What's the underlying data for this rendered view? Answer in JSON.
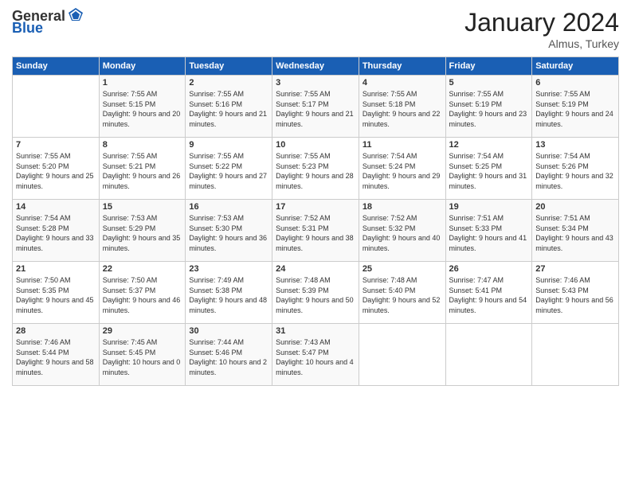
{
  "header": {
    "logo_general": "General",
    "logo_blue": "Blue",
    "month_title": "January 2024",
    "location": "Almus, Turkey"
  },
  "weekdays": [
    "Sunday",
    "Monday",
    "Tuesday",
    "Wednesday",
    "Thursday",
    "Friday",
    "Saturday"
  ],
  "weeks": [
    [
      {
        "day": "",
        "sunrise": "",
        "sunset": "",
        "daylight": ""
      },
      {
        "day": "1",
        "sunrise": "Sunrise: 7:55 AM",
        "sunset": "Sunset: 5:15 PM",
        "daylight": "Daylight: 9 hours and 20 minutes."
      },
      {
        "day": "2",
        "sunrise": "Sunrise: 7:55 AM",
        "sunset": "Sunset: 5:16 PM",
        "daylight": "Daylight: 9 hours and 21 minutes."
      },
      {
        "day": "3",
        "sunrise": "Sunrise: 7:55 AM",
        "sunset": "Sunset: 5:17 PM",
        "daylight": "Daylight: 9 hours and 21 minutes."
      },
      {
        "day": "4",
        "sunrise": "Sunrise: 7:55 AM",
        "sunset": "Sunset: 5:18 PM",
        "daylight": "Daylight: 9 hours and 22 minutes."
      },
      {
        "day": "5",
        "sunrise": "Sunrise: 7:55 AM",
        "sunset": "Sunset: 5:19 PM",
        "daylight": "Daylight: 9 hours and 23 minutes."
      },
      {
        "day": "6",
        "sunrise": "Sunrise: 7:55 AM",
        "sunset": "Sunset: 5:19 PM",
        "daylight": "Daylight: 9 hours and 24 minutes."
      }
    ],
    [
      {
        "day": "7",
        "sunrise": "Sunrise: 7:55 AM",
        "sunset": "Sunset: 5:20 PM",
        "daylight": "Daylight: 9 hours and 25 minutes."
      },
      {
        "day": "8",
        "sunrise": "Sunrise: 7:55 AM",
        "sunset": "Sunset: 5:21 PM",
        "daylight": "Daylight: 9 hours and 26 minutes."
      },
      {
        "day": "9",
        "sunrise": "Sunrise: 7:55 AM",
        "sunset": "Sunset: 5:22 PM",
        "daylight": "Daylight: 9 hours and 27 minutes."
      },
      {
        "day": "10",
        "sunrise": "Sunrise: 7:55 AM",
        "sunset": "Sunset: 5:23 PM",
        "daylight": "Daylight: 9 hours and 28 minutes."
      },
      {
        "day": "11",
        "sunrise": "Sunrise: 7:54 AM",
        "sunset": "Sunset: 5:24 PM",
        "daylight": "Daylight: 9 hours and 29 minutes."
      },
      {
        "day": "12",
        "sunrise": "Sunrise: 7:54 AM",
        "sunset": "Sunset: 5:25 PM",
        "daylight": "Daylight: 9 hours and 31 minutes."
      },
      {
        "day": "13",
        "sunrise": "Sunrise: 7:54 AM",
        "sunset": "Sunset: 5:26 PM",
        "daylight": "Daylight: 9 hours and 32 minutes."
      }
    ],
    [
      {
        "day": "14",
        "sunrise": "Sunrise: 7:54 AM",
        "sunset": "Sunset: 5:28 PM",
        "daylight": "Daylight: 9 hours and 33 minutes."
      },
      {
        "day": "15",
        "sunrise": "Sunrise: 7:53 AM",
        "sunset": "Sunset: 5:29 PM",
        "daylight": "Daylight: 9 hours and 35 minutes."
      },
      {
        "day": "16",
        "sunrise": "Sunrise: 7:53 AM",
        "sunset": "Sunset: 5:30 PM",
        "daylight": "Daylight: 9 hours and 36 minutes."
      },
      {
        "day": "17",
        "sunrise": "Sunrise: 7:52 AM",
        "sunset": "Sunset: 5:31 PM",
        "daylight": "Daylight: 9 hours and 38 minutes."
      },
      {
        "day": "18",
        "sunrise": "Sunrise: 7:52 AM",
        "sunset": "Sunset: 5:32 PM",
        "daylight": "Daylight: 9 hours and 40 minutes."
      },
      {
        "day": "19",
        "sunrise": "Sunrise: 7:51 AM",
        "sunset": "Sunset: 5:33 PM",
        "daylight": "Daylight: 9 hours and 41 minutes."
      },
      {
        "day": "20",
        "sunrise": "Sunrise: 7:51 AM",
        "sunset": "Sunset: 5:34 PM",
        "daylight": "Daylight: 9 hours and 43 minutes."
      }
    ],
    [
      {
        "day": "21",
        "sunrise": "Sunrise: 7:50 AM",
        "sunset": "Sunset: 5:35 PM",
        "daylight": "Daylight: 9 hours and 45 minutes."
      },
      {
        "day": "22",
        "sunrise": "Sunrise: 7:50 AM",
        "sunset": "Sunset: 5:37 PM",
        "daylight": "Daylight: 9 hours and 46 minutes."
      },
      {
        "day": "23",
        "sunrise": "Sunrise: 7:49 AM",
        "sunset": "Sunset: 5:38 PM",
        "daylight": "Daylight: 9 hours and 48 minutes."
      },
      {
        "day": "24",
        "sunrise": "Sunrise: 7:48 AM",
        "sunset": "Sunset: 5:39 PM",
        "daylight": "Daylight: 9 hours and 50 minutes."
      },
      {
        "day": "25",
        "sunrise": "Sunrise: 7:48 AM",
        "sunset": "Sunset: 5:40 PM",
        "daylight": "Daylight: 9 hours and 52 minutes."
      },
      {
        "day": "26",
        "sunrise": "Sunrise: 7:47 AM",
        "sunset": "Sunset: 5:41 PM",
        "daylight": "Daylight: 9 hours and 54 minutes."
      },
      {
        "day": "27",
        "sunrise": "Sunrise: 7:46 AM",
        "sunset": "Sunset: 5:43 PM",
        "daylight": "Daylight: 9 hours and 56 minutes."
      }
    ],
    [
      {
        "day": "28",
        "sunrise": "Sunrise: 7:46 AM",
        "sunset": "Sunset: 5:44 PM",
        "daylight": "Daylight: 9 hours and 58 minutes."
      },
      {
        "day": "29",
        "sunrise": "Sunrise: 7:45 AM",
        "sunset": "Sunset: 5:45 PM",
        "daylight": "Daylight: 10 hours and 0 minutes."
      },
      {
        "day": "30",
        "sunrise": "Sunrise: 7:44 AM",
        "sunset": "Sunset: 5:46 PM",
        "daylight": "Daylight: 10 hours and 2 minutes."
      },
      {
        "day": "31",
        "sunrise": "Sunrise: 7:43 AM",
        "sunset": "Sunset: 5:47 PM",
        "daylight": "Daylight: 10 hours and 4 minutes."
      },
      {
        "day": "",
        "sunrise": "",
        "sunset": "",
        "daylight": ""
      },
      {
        "day": "",
        "sunrise": "",
        "sunset": "",
        "daylight": ""
      },
      {
        "day": "",
        "sunrise": "",
        "sunset": "",
        "daylight": ""
      }
    ]
  ]
}
